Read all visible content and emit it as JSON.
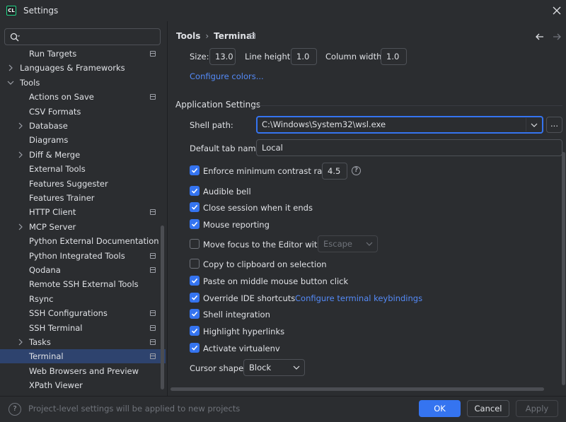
{
  "window": {
    "title": "Settings",
    "app_icon_text": "CL"
  },
  "sidebar": {
    "search": {
      "placeholder": "",
      "value": ""
    },
    "items": [
      {
        "label": "Run Targets",
        "level": 2,
        "project": true
      },
      {
        "label": "Languages & Frameworks",
        "level": 1,
        "chevron": "right"
      },
      {
        "label": "Tools",
        "level": 1,
        "chevron": "down"
      },
      {
        "label": "Actions on Save",
        "level": 2,
        "project": true
      },
      {
        "label": "CSV Formats",
        "level": 2
      },
      {
        "label": "Database",
        "level": 2,
        "chevron": "right"
      },
      {
        "label": "Diagrams",
        "level": 2
      },
      {
        "label": "Diff & Merge",
        "level": 2,
        "chevron": "right"
      },
      {
        "label": "External Tools",
        "level": 2
      },
      {
        "label": "Features Suggester",
        "level": 2
      },
      {
        "label": "Features Trainer",
        "level": 2
      },
      {
        "label": "HTTP Client",
        "level": 2,
        "project": true
      },
      {
        "label": "MCP Server",
        "level": 2,
        "chevron": "right"
      },
      {
        "label": "Python External Documentation",
        "level": 2
      },
      {
        "label": "Python Integrated Tools",
        "level": 2,
        "project": true
      },
      {
        "label": "Qodana",
        "level": 2,
        "project": true
      },
      {
        "label": "Remote SSH External Tools",
        "level": 2
      },
      {
        "label": "Rsync",
        "level": 2
      },
      {
        "label": "SSH Configurations",
        "level": 2,
        "project": true
      },
      {
        "label": "SSH Terminal",
        "level": 2,
        "project": true
      },
      {
        "label": "Tasks",
        "level": 2,
        "chevron": "right",
        "project": true
      },
      {
        "label": "Terminal",
        "level": 2,
        "project": true,
        "selected": true
      },
      {
        "label": "Web Browsers and Preview",
        "level": 2
      },
      {
        "label": "XPath Viewer",
        "level": 2
      }
    ]
  },
  "breadcrumb": {
    "parent": "Tools",
    "separator": "›",
    "current": "Terminal"
  },
  "font_row": {
    "size_label": "Size:",
    "size_value": "13.0",
    "line_height_label": "Line height:",
    "line_height_value": "1.0",
    "column_width_label": "Column width:",
    "column_width_value": "1.0"
  },
  "configure_colors": "Configure colors...",
  "app_settings": {
    "title": "Application Settings",
    "shell_path_label": "Shell path:",
    "shell_path_value": "C:\\Windows\\System32\\wsl.exe",
    "browse_label": "...",
    "default_tab_label": "Default tab name:",
    "default_tab_value": "Local",
    "contrast_label": "Enforce minimum contrast ratio:",
    "contrast_value": "4.5",
    "audible_bell": "Audible bell",
    "close_session": "Close session when it ends",
    "mouse_reporting": "Mouse reporting",
    "move_focus": "Move focus to the Editor with:",
    "move_focus_value": "Escape",
    "copy_clipboard": "Copy to clipboard on selection",
    "paste_middle": "Paste on middle mouse button click",
    "override_shortcuts": "Override IDE shortcuts",
    "configure_keybindings": "Configure terminal keybindings",
    "shell_integration": "Shell integration",
    "highlight_hyperlinks": "Highlight hyperlinks",
    "activate_virtualenv": "Activate virtualenv",
    "cursor_shape_label": "Cursor shape:",
    "cursor_shape_value": "Block"
  },
  "checkbox_states": {
    "contrast": true,
    "audible_bell": true,
    "close_session": true,
    "mouse_reporting": true,
    "move_focus": false,
    "copy_clipboard": false,
    "paste_middle": true,
    "override_shortcuts": true,
    "shell_integration": true,
    "highlight_hyperlinks": true,
    "activate_virtualenv": true
  },
  "footer": {
    "help": "?",
    "note": "Project-level settings will be applied to new projects",
    "ok": "OK",
    "cancel": "Cancel",
    "apply": "Apply"
  },
  "colors": {
    "accent": "#3574f0",
    "background": "#2b2d30",
    "selection": "#2e436e",
    "link": "#548af7"
  }
}
